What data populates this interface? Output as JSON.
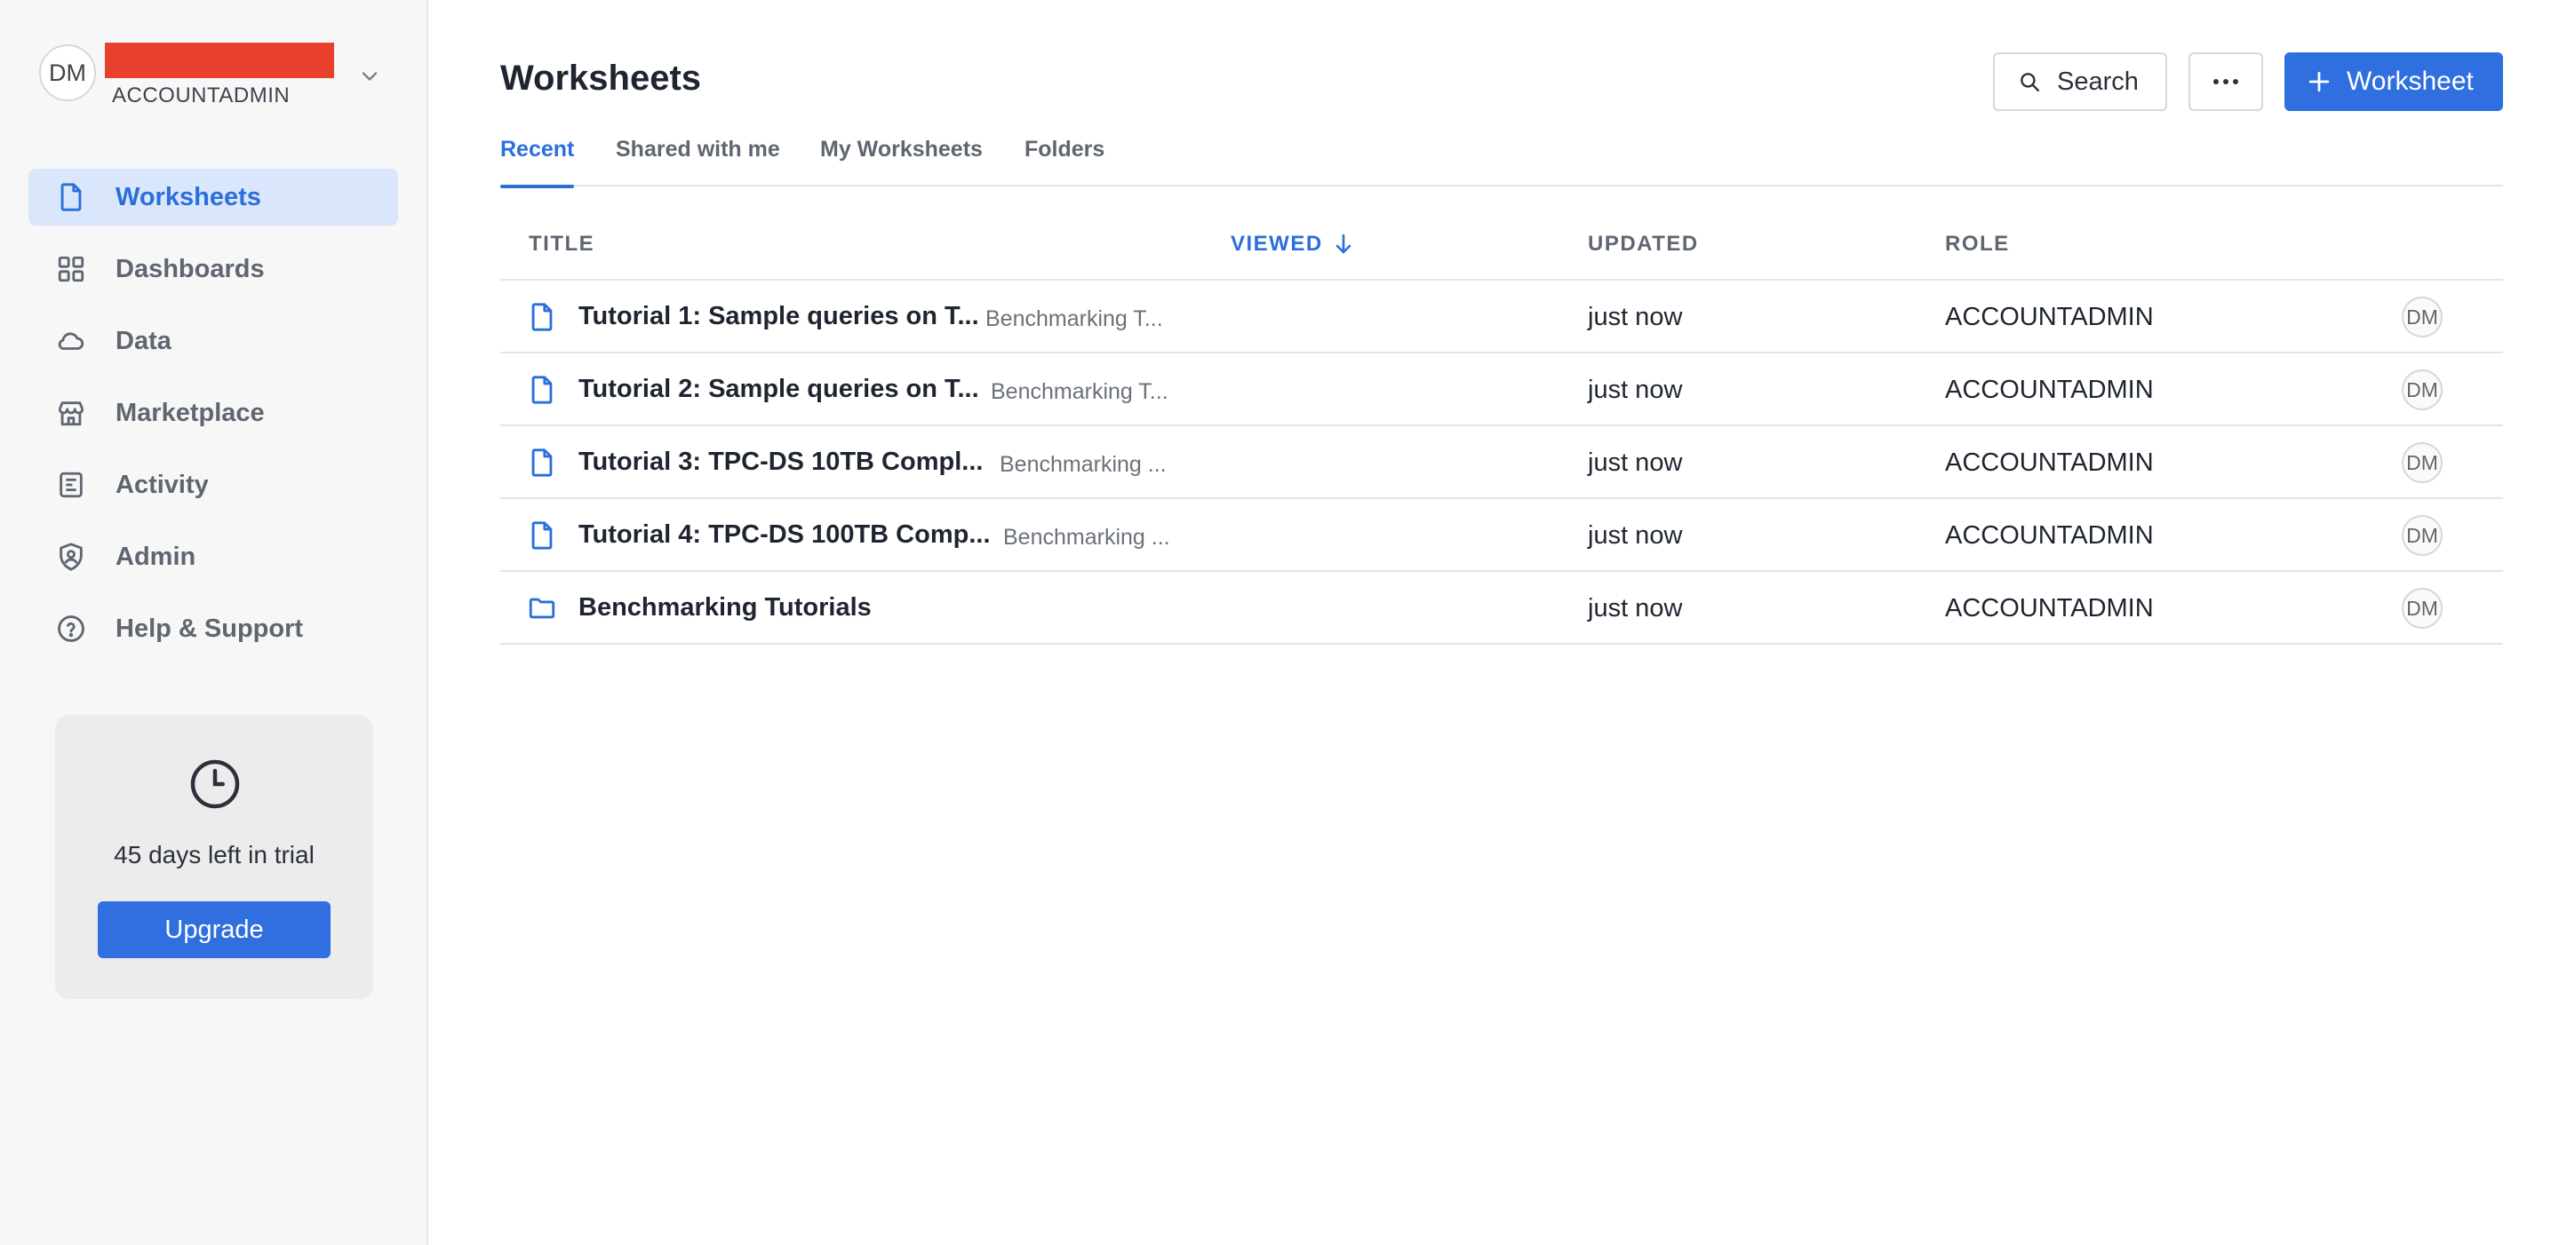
{
  "account": {
    "initials": "DM",
    "role": "ACCOUNTADMIN"
  },
  "nav": {
    "items": [
      {
        "label": "Worksheets",
        "icon": "file-icon",
        "active": true
      },
      {
        "label": "Dashboards",
        "icon": "grid-icon"
      },
      {
        "label": "Data",
        "icon": "cloud-icon"
      },
      {
        "label": "Marketplace",
        "icon": "store-icon"
      },
      {
        "label": "Activity",
        "icon": "activity-icon"
      },
      {
        "label": "Admin",
        "icon": "shield-icon"
      },
      {
        "label": "Help & Support",
        "icon": "help-icon"
      }
    ]
  },
  "trial": {
    "text": "45 days left in trial",
    "upgrade_label": "Upgrade",
    "icon": "clock-icon"
  },
  "header": {
    "title": "Worksheets",
    "search_label": "Search",
    "new_label": "Worksheet"
  },
  "tabs": [
    {
      "label": "Recent",
      "active": true
    },
    {
      "label": "Shared with me"
    },
    {
      "label": "My Worksheets"
    },
    {
      "label": "Folders"
    }
  ],
  "table": {
    "columns": {
      "title": "TITLE",
      "viewed": "VIEWED",
      "updated": "UPDATED",
      "role": "ROLE"
    },
    "rows": [
      {
        "type": "worksheet",
        "title": "Tutorial 1: Sample queries on T...",
        "folder": "Benchmarking T...",
        "updated": "just now",
        "role": "ACCOUNTADMIN",
        "owner": "DM"
      },
      {
        "type": "worksheet",
        "title": "Tutorial 2: Sample queries on T...",
        "folder": "Benchmarking T...",
        "updated": "just now",
        "role": "ACCOUNTADMIN",
        "owner": "DM"
      },
      {
        "type": "worksheet",
        "title": "Tutorial 3: TPC-DS 10TB Compl...",
        "folder": "Benchmarking ...",
        "updated": "just now",
        "role": "ACCOUNTADMIN",
        "owner": "DM"
      },
      {
        "type": "worksheet",
        "title": "Tutorial 4: TPC-DS 100TB Comp...",
        "folder": "Benchmarking ...",
        "updated": "just now",
        "role": "ACCOUNTADMIN",
        "owner": "DM"
      },
      {
        "type": "folder",
        "title": "Benchmarking Tutorials",
        "folder": "",
        "updated": "just now",
        "role": "ACCOUNTADMIN",
        "owner": "DM"
      }
    ]
  },
  "colors": {
    "accent": "#2f6fe0",
    "active_nav_bg": "#d9e6fb",
    "redaction": "#e8402c"
  }
}
